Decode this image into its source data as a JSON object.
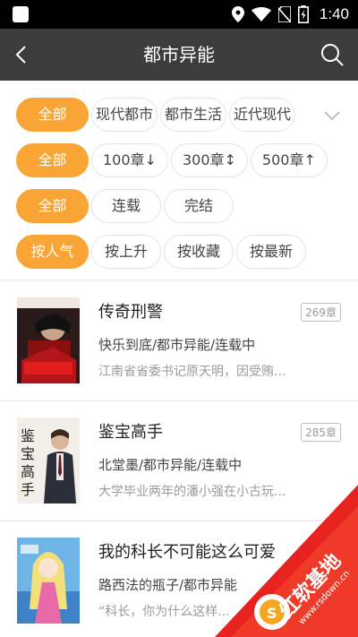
{
  "status_bar": {
    "time": "1:40"
  },
  "header": {
    "title": "都市异能"
  },
  "filters": {
    "category": [
      "全部",
      "现代都市",
      "都市生活",
      "近代现代"
    ],
    "length": [
      "全部",
      "100章↓",
      "300章↕",
      "500章↑"
    ],
    "status": [
      "全部",
      "连载",
      "完结"
    ],
    "sort": [
      "按人气",
      "按上升",
      "按收藏",
      "按最新"
    ]
  },
  "books": [
    {
      "title": "传奇刑警",
      "chapters": "269章",
      "meta": "快乐到底/都市异能/连载中",
      "desc": "江南省省委书记原天明，因受贿..."
    },
    {
      "title": "鉴宝高手",
      "chapters": "285章",
      "meta": "北堂墨/都市异能/连载中",
      "desc": "大学毕业两年的潘小强在小古玩..."
    },
    {
      "title": "我的科长不可能这么可爱",
      "chapters": "",
      "meta": "路西法的瓶子/都市异能",
      "desc": "“科长，你为什么这样..."
    }
  ],
  "colors": {
    "accent": "#f8a535",
    "header_bg": "#3c3c3c"
  },
  "watermark": {
    "brand": "红软基地",
    "url": "www.rsdown.cn"
  }
}
